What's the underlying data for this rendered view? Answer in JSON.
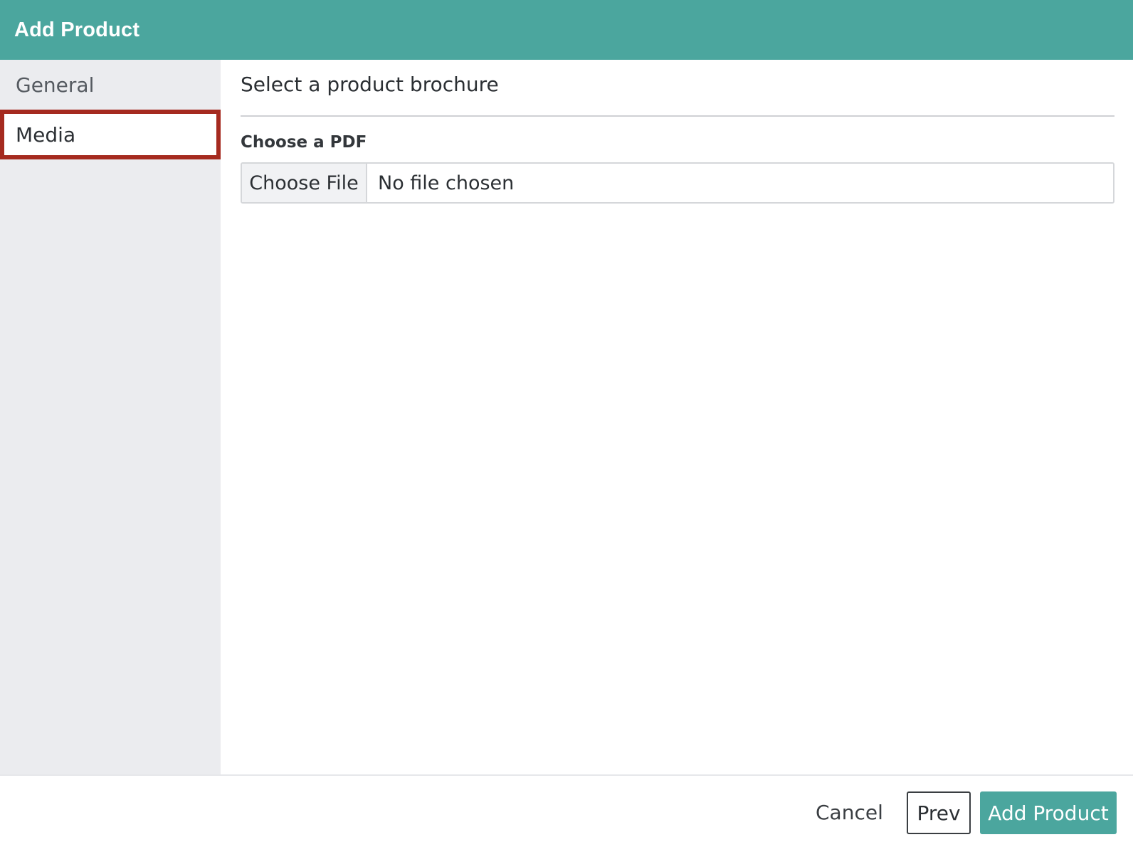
{
  "header": {
    "title": "Add Product"
  },
  "sidebar": {
    "items": [
      {
        "label": "General",
        "active": false
      },
      {
        "label": "Media",
        "active": true
      }
    ]
  },
  "main": {
    "section_title": "Select a product brochure",
    "field_label": "Choose a PDF",
    "file_input": {
      "button_label": "Choose File",
      "status": "No file chosen"
    }
  },
  "footer": {
    "cancel_label": "Cancel",
    "prev_label": "Prev",
    "submit_label": "Add Product"
  },
  "colors": {
    "accent": "#4ba69e",
    "sidebar_bg": "#ebecef",
    "highlight_border": "#a52a1f"
  }
}
